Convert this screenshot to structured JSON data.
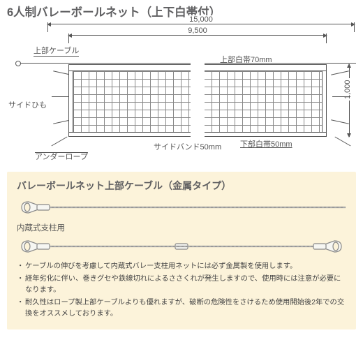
{
  "title": "6人制バレーボールネット（上下白帯付）",
  "dimensions": {
    "overall_width": "15,000",
    "net_width": "9,500",
    "net_height": "1,000"
  },
  "labels": {
    "upper_cable": "上部ケーブル",
    "side_himo": "サイドひも",
    "under_rope": "アンダーロープ",
    "upper_band": "上部白帯70mm",
    "side_band": "サイドバンド50mm",
    "lower_band": "下部白帯50mm"
  },
  "yellow": {
    "title": "バレーボールネット上部ケーブル（金属タイプ）",
    "sublabel": "内蔵式支柱用",
    "bullets": [
      "ケーブルの伸びを考慮して内蔵式バレー支柱用ネットには必ず金属製を使用します。",
      "経年劣化に伴い、巻きグセや鉄線切れによるささくれが発生しますので、使用時には注意が必要になります。",
      "耐久性はロープ製上部ケーブルよりも優れますが、破断の危険性をさけるため使用開始後2年での交換をオススメしております。"
    ]
  }
}
